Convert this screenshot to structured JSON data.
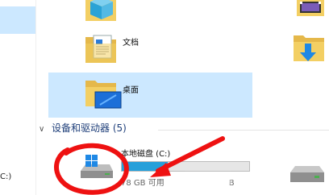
{
  "nav": {
    "bottom_label": "C:)"
  },
  "folders": {
    "documents_label": "文档",
    "desktop_label": "桌面"
  },
  "section": {
    "title": "设备和驱动器 (5)"
  },
  "drive": {
    "name": "本地磁盘 (C:)",
    "space_text_left": "78 GB 可用",
    "space_text_right": "B",
    "used_fraction": 0.36
  },
  "colors": {
    "selection": "#cce8ff",
    "usage_bar": "#26a0da",
    "annotation": "#ee1111",
    "folder": "#f3cf63"
  },
  "icons": {
    "top_left": "3d-objects-folder-icon",
    "top_right": "videos-folder-icon",
    "right_mid": "downloads-folder-icon",
    "drive_main": "windows-drive-icon",
    "drive_second": "drive-icon"
  }
}
